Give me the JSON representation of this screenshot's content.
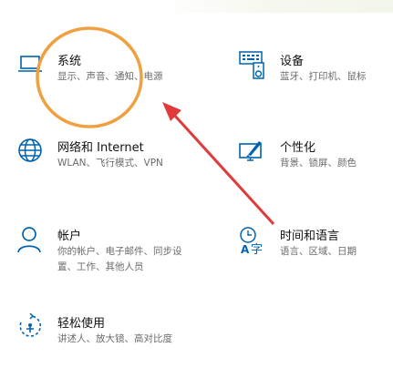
{
  "tiles": [
    {
      "id": "system",
      "title": "系统",
      "desc": [
        "显示、声音、通知、电源"
      ],
      "icon": "laptop-icon"
    },
    {
      "id": "devices",
      "title": "设备",
      "desc": [
        "蓝牙、打印机、鼠标"
      ],
      "icon": "devices-icon"
    },
    {
      "id": "network",
      "title": "网络和 Internet",
      "desc": [
        "WLAN、飞行模式、VPN"
      ],
      "icon": "globe-icon"
    },
    {
      "id": "personalization",
      "title": "个性化",
      "desc": [
        "背景、锁屏、颜色"
      ],
      "icon": "personalization-icon"
    },
    {
      "id": "accounts",
      "title": "帐户",
      "desc": [
        "你的帐户、电子邮件、同步设",
        "置、工作、其他人员"
      ],
      "icon": "person-icon"
    },
    {
      "id": "time-language",
      "title": "时间和语言",
      "desc": [
        "语言、区域、日期"
      ],
      "icon": "time-language-icon"
    },
    {
      "id": "ease-of-access",
      "title": "轻松使用",
      "desc": [
        "讲述人、放大镜、高对比度"
      ],
      "icon": "ease-of-access-icon"
    }
  ],
  "colors": {
    "accent": "#0063b1",
    "annotation_circle": "#f0a040",
    "annotation_arrow": "#e03a3a"
  }
}
